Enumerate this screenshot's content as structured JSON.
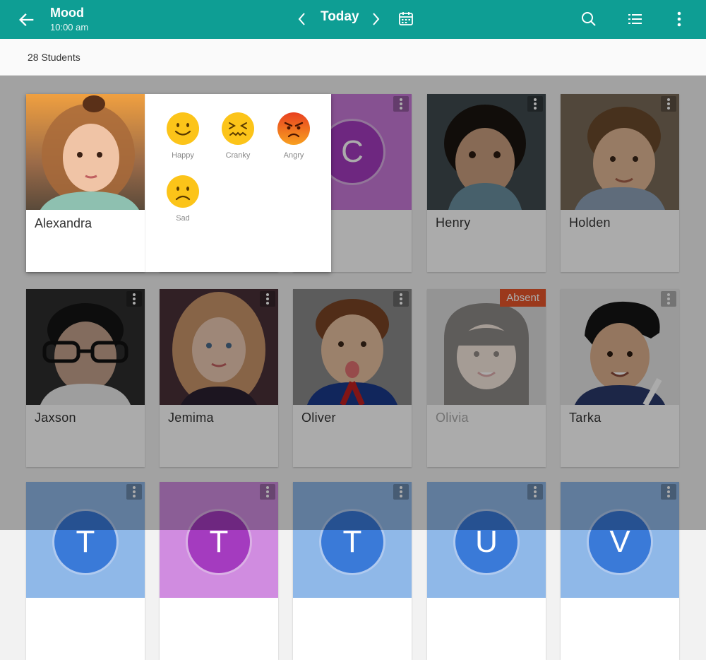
{
  "header": {
    "title": "Mood",
    "subtitle": "10:00 am",
    "date_label": "Today",
    "colors": {
      "appbar": "#0e9e94"
    }
  },
  "student_count": "28 Students",
  "students": [
    {
      "name": "Alexandra"
    },
    {
      "name": "Henry"
    },
    {
      "name": "Holden"
    },
    {
      "name": "Jaxson"
    },
    {
      "name": "Jemima"
    },
    {
      "name": "Oliver"
    },
    {
      "name": "Olivia",
      "status": "Absent"
    },
    {
      "name": "Tarka"
    }
  ],
  "partial_card": {
    "initial": "C",
    "name_fragment": "e"
  },
  "placeholder_initials": [
    "T",
    "T",
    "T",
    "U",
    "V"
  ],
  "mood_popup": {
    "student": "Alexandra",
    "moods": [
      {
        "label": "Happy",
        "icon": "happy-face-icon"
      },
      {
        "label": "Cranky",
        "icon": "cranky-face-icon"
      },
      {
        "label": "Angry",
        "icon": "angry-face-icon"
      },
      {
        "label": "Sad",
        "icon": "sad-face-icon"
      }
    ]
  }
}
